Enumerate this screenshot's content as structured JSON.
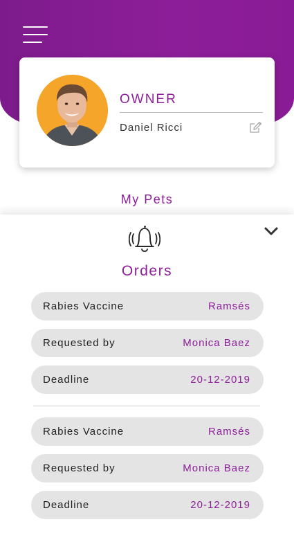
{
  "header": {
    "menu_icon": "hamburger-menu-icon"
  },
  "profile": {
    "role": "OWNER",
    "name": "Daniel Ricci",
    "edit_icon": "edit-pencil-icon"
  },
  "section": {
    "my_pets": "My Pets"
  },
  "orders_panel": {
    "icon": "bell-icon",
    "collapse_icon": "chevron-down-icon",
    "title": "Orders",
    "orders": [
      {
        "rows": [
          {
            "label": "Rabies Vaccine",
            "value": "Ramsés"
          },
          {
            "label": "Requested by",
            "value": "Monica Baez"
          },
          {
            "label": "Deadline",
            "value": "20-12-2019"
          }
        ]
      },
      {
        "rows": [
          {
            "label": "Rabies Vaccine",
            "value": "Ramsés"
          },
          {
            "label": "Requested by",
            "value": "Monica Baez"
          },
          {
            "label": "Deadline",
            "value": "20-12-2019"
          }
        ]
      }
    ]
  },
  "colors": {
    "brand_purple": "#8d1e99",
    "pill_bg": "#e4e4e4"
  }
}
